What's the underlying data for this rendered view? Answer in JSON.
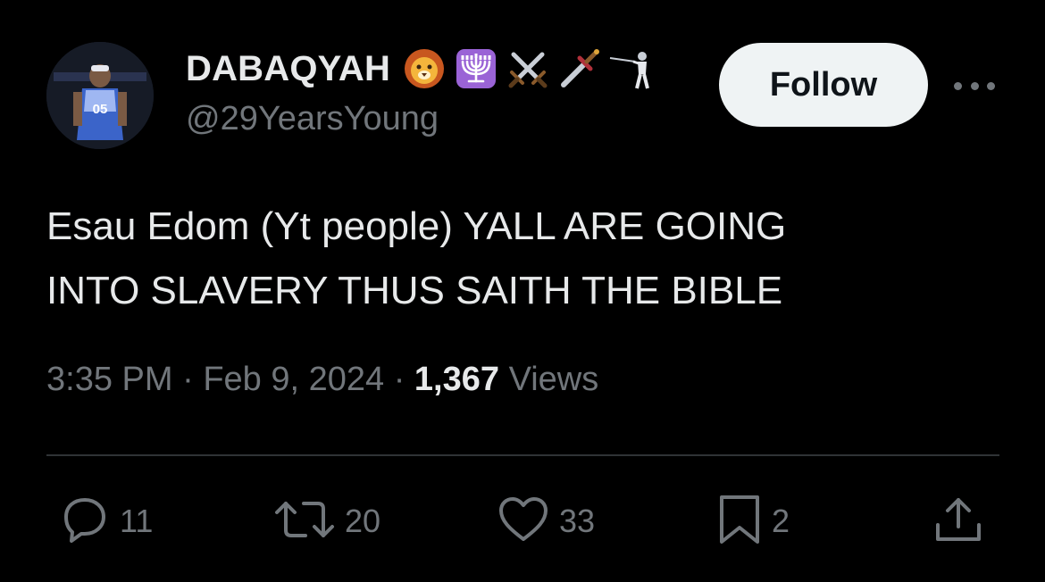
{
  "author": {
    "display_name": "DABAQYAH",
    "handle": "@29YearsYoung",
    "name_emojis": [
      "lion-icon",
      "menorah-icon",
      "crossed-swords-icon",
      "dagger-icon",
      "fencer-icon"
    ]
  },
  "follow_button": {
    "label": "Follow"
  },
  "tweet": {
    "text_line1": "Esau Edom (Yt people) YALL ARE GOING",
    "text_line2": "INTO SLAVERY THUS SAITH THE BIBLE",
    "time": "3:35 PM",
    "separator": " · ",
    "date": "Feb 9, 2024",
    "views_count": "1,367",
    "views_label": " Views"
  },
  "actions": {
    "replies": "11",
    "reposts": "20",
    "likes": "33",
    "bookmarks": "2"
  },
  "colors": {
    "background": "#000000",
    "primary_text": "#e7e9ea",
    "secondary_text": "#71767b",
    "divider": "#2f3336",
    "follow_bg": "#eff3f4",
    "follow_text": "#0f1419"
  }
}
